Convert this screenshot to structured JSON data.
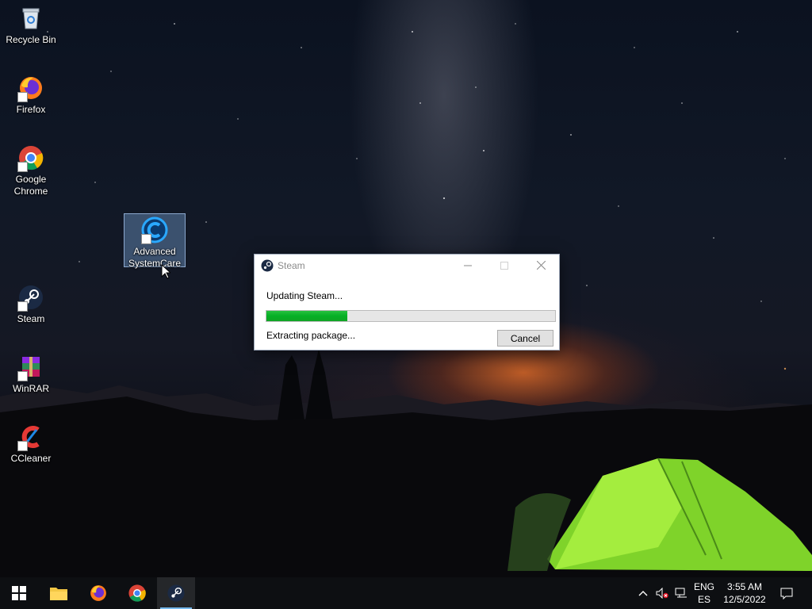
{
  "desktop": {
    "icons": [
      {
        "label": "Recycle Bin",
        "icon": "recycle-bin-icon"
      },
      {
        "label": "Firefox",
        "icon": "firefox-icon"
      },
      {
        "label": "Google Chrome",
        "icon": "chrome-icon"
      },
      {
        "label": "Advanced SystemCare",
        "icon": "advanced-systemcare-icon"
      },
      {
        "label": "Steam",
        "icon": "steam-icon"
      },
      {
        "label": "WinRAR",
        "icon": "winrar-icon"
      },
      {
        "label": "CCleaner",
        "icon": "ccleaner-icon"
      }
    ]
  },
  "dialog": {
    "title": "Steam",
    "status": "Updating Steam...",
    "progress": 0.28,
    "substatus": "Extracting package...",
    "cancel_label": "Cancel",
    "progress_color": "#06b025"
  },
  "taskbar": {
    "apps": [
      "start-icon",
      "file-explorer-icon",
      "firefox-icon",
      "chrome-icon",
      "steam-icon"
    ],
    "active_app": "steam",
    "language": {
      "line1": "ENG",
      "line2": "ES"
    },
    "clock": {
      "time": "3:55 AM",
      "date": "12/5/2022"
    },
    "accent_color": "#76b9ed"
  }
}
